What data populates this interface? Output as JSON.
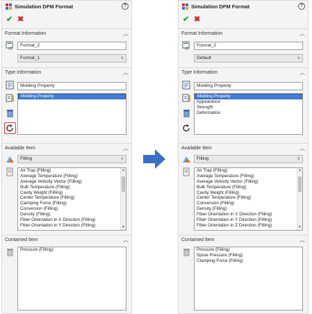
{
  "panels": [
    {
      "title": "Simulation DFM Format",
      "help_glyph": "?",
      "ok_glyph": "✔",
      "cancel_glyph": "✖",
      "format_information": {
        "title": "Format Information",
        "name_value": "Format_2",
        "source_value": "Format_1"
      },
      "type_information": {
        "title": "Type Information",
        "type_value": "Molding Property",
        "list_items": [
          "Molding Property"
        ]
      },
      "available_item": {
        "title": "Available Item",
        "category_value": "Filling",
        "list_items": [
          "Air Trap (Filling)",
          "Average Temperature (Filling)",
          "Average Velocity Vector (Filling)",
          "Bulk Temperature (Filling)",
          "Cavity Weight (Filling)",
          "Center Temperature (Filling)",
          "Clamping Force (Filling)",
          "Conversion (Filling)",
          "Density (Filling)",
          "Fiber Orientation in X Direction (Filling)",
          "Fiber Orientation in Y Direction (Filling)"
        ]
      },
      "contained_item": {
        "title": "Contained Item",
        "list_items": [
          "Pressure (Filling)"
        ]
      }
    },
    {
      "title": "Simulation DFM Format",
      "help_glyph": "?",
      "ok_glyph": "✔",
      "cancel_glyph": "✖",
      "format_information": {
        "title": "Format Information",
        "name_value": "Format_2",
        "source_value": "Default"
      },
      "type_information": {
        "title": "Type Information",
        "type_value": "Molding Property",
        "list_items": [
          "Molding Property",
          "Appearance",
          "Strength",
          "Deformation"
        ]
      },
      "available_item": {
        "title": "Available Item",
        "category_value": "Filling",
        "list_items": [
          "Air Trap (Filling)",
          "Average Temperature (Filling)",
          "Average Velocity Vector (Filling)",
          "Bulk Temperature (Filling)",
          "Cavity Weight (Filling)",
          "Center Temperature (Filling)",
          "Conversion (Filling)",
          "Density (Filling)",
          "Fiber Orientation in X Direction (Filling)",
          "Fiber Orientation in Y Direction (Filling)",
          "Fiber Orientation in Z Direction (Filling)"
        ]
      },
      "contained_item": {
        "title": "Contained Item",
        "list_items": [
          "Pressure (Filling)",
          "Sprue Pressure (Filling)",
          "Clamping Force (Filling)"
        ]
      }
    }
  ],
  "colors": {
    "accent": "#3f7fd8",
    "ok": "#1ea33b",
    "cancel": "#d8282f",
    "highlight": "#e0403a",
    "arrow": "#3a6fc4"
  },
  "icons": {
    "app": "dfm-format-icon",
    "format": "format-number-icon",
    "type": "molding-property-icon",
    "add": "add-type-icon",
    "delete": "trash-icon",
    "refresh": "refresh-icon",
    "category": "filling-result-icon",
    "available": "available-list-icon",
    "contained": "trash-icon"
  }
}
